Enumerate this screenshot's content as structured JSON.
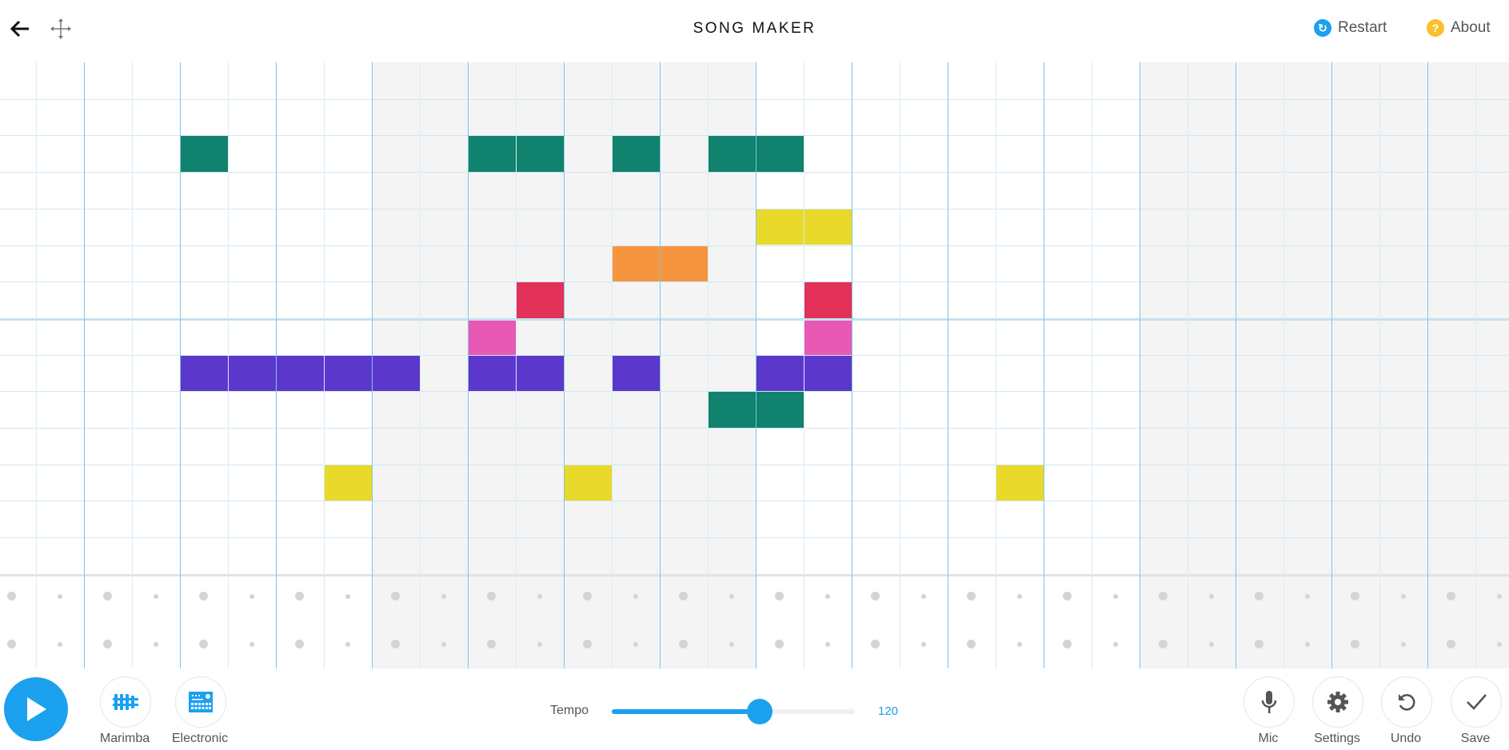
{
  "header": {
    "title": "SONG MAKER",
    "restart_label": "Restart",
    "about_label": "About",
    "about_icon_text": "?",
    "restart_icon_text": "↻"
  },
  "colors": {
    "accent": "#1ba1ee",
    "restart_icon": "#1ba1ee",
    "about_icon": "#f8c12d",
    "bar_shade": "#f4f4f4"
  },
  "grid": {
    "rows": 14,
    "columns": 32,
    "steps_per_bar": 8,
    "octave_line_after_row": 6,
    "notes": [
      {
        "col": 4,
        "row": 2,
        "color": "#11826d"
      },
      {
        "col": 10,
        "row": 2,
        "color": "#11826d"
      },
      {
        "col": 11,
        "row": 2,
        "color": "#11826d"
      },
      {
        "col": 13,
        "row": 2,
        "color": "#11826d"
      },
      {
        "col": 15,
        "row": 2,
        "color": "#11826d"
      },
      {
        "col": 16,
        "row": 2,
        "color": "#11826d"
      },
      {
        "col": 16,
        "row": 4,
        "color": "#e8d92a"
      },
      {
        "col": 17,
        "row": 4,
        "color": "#e8d92a"
      },
      {
        "col": 13,
        "row": 5,
        "color": "#f7953f"
      },
      {
        "col": 14,
        "row": 5,
        "color": "#f7953f"
      },
      {
        "col": 11,
        "row": 6,
        "color": "#e3315a"
      },
      {
        "col": 17,
        "row": 6,
        "color": "#e3315a"
      },
      {
        "col": 10,
        "row": 7,
        "color": "#e759b5"
      },
      {
        "col": 17,
        "row": 7,
        "color": "#e759b5"
      },
      {
        "col": 4,
        "row": 8,
        "color": "#5b37cc"
      },
      {
        "col": 5,
        "row": 8,
        "color": "#5b37cc"
      },
      {
        "col": 6,
        "row": 8,
        "color": "#5b37cc"
      },
      {
        "col": 7,
        "row": 8,
        "color": "#5b37cc"
      },
      {
        "col": 8,
        "row": 8,
        "color": "#5b37cc"
      },
      {
        "col": 10,
        "row": 8,
        "color": "#5b37cc"
      },
      {
        "col": 11,
        "row": 8,
        "color": "#5b37cc"
      },
      {
        "col": 13,
        "row": 8,
        "color": "#5b37cc"
      },
      {
        "col": 16,
        "row": 8,
        "color": "#5b37cc"
      },
      {
        "col": 17,
        "row": 8,
        "color": "#5b37cc"
      },
      {
        "col": 15,
        "row": 9,
        "color": "#11826d"
      },
      {
        "col": 16,
        "row": 9,
        "color": "#11826d"
      },
      {
        "col": 7,
        "row": 11,
        "color": "#e8d92a"
      },
      {
        "col": 12,
        "row": 11,
        "color": "#e8d92a"
      },
      {
        "col": 21,
        "row": 11,
        "color": "#e8d92a"
      }
    ],
    "percussion_rows": 2
  },
  "footer": {
    "instruments": [
      {
        "label": "Marimba",
        "icon": "marimba-icon"
      },
      {
        "label": "Electronic",
        "icon": "drum-machine-icon"
      }
    ],
    "tempo_label": "Tempo",
    "tempo_value": "120",
    "tempo_fraction": 0.61,
    "actions": [
      {
        "label": "Mic",
        "icon": "mic-icon"
      },
      {
        "label": "Settings",
        "icon": "gear-icon"
      },
      {
        "label": "Undo",
        "icon": "undo-icon"
      },
      {
        "label": "Save",
        "icon": "check-icon"
      }
    ]
  }
}
